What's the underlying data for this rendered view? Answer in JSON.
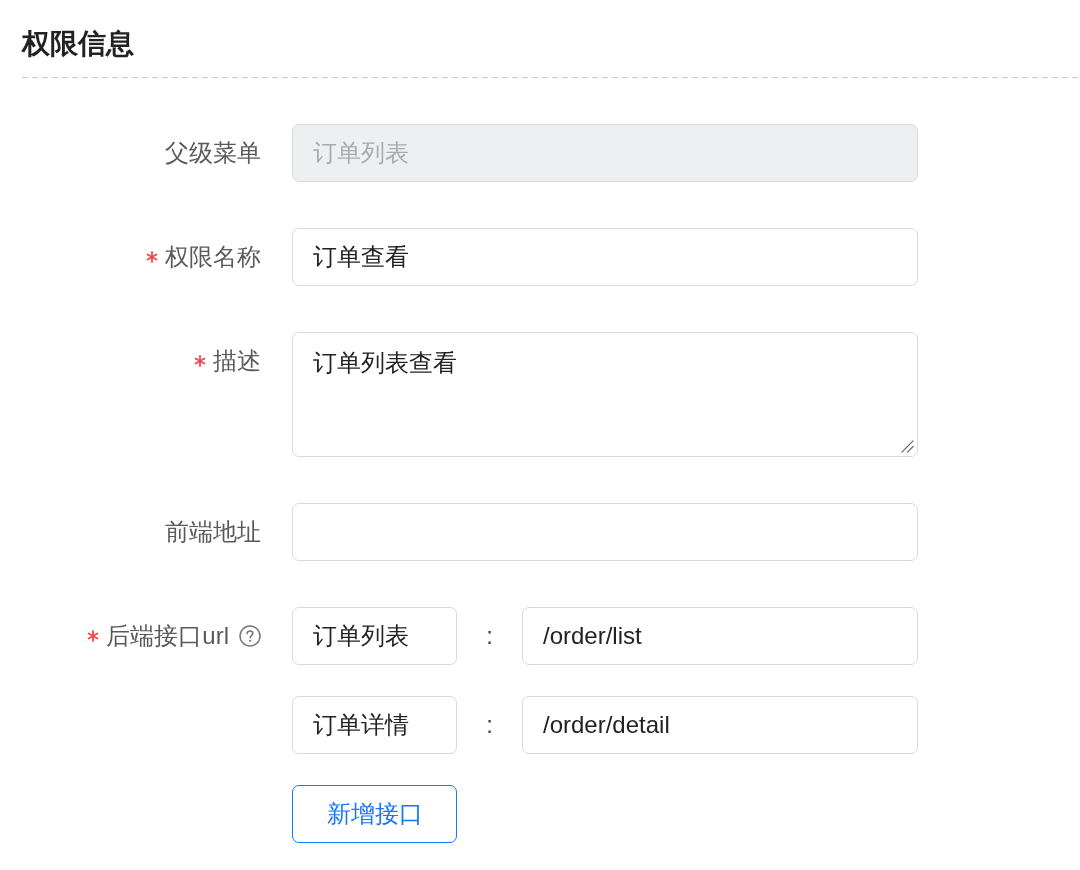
{
  "section": {
    "title": "权限信息"
  },
  "fields": [
    {
      "kind": "text",
      "label": "父级菜单",
      "required": false,
      "help": false,
      "disabled": true,
      "value": "订单列表"
    },
    {
      "kind": "text",
      "label": "权限名称",
      "required": true,
      "help": false,
      "disabled": false,
      "value": "订单查看"
    },
    {
      "kind": "textarea",
      "label": "描述",
      "required": true,
      "help": false,
      "disabled": false,
      "value": "订单列表查看"
    },
    {
      "kind": "text",
      "label": "前端地址",
      "required": false,
      "help": false,
      "disabled": false
    },
    {
      "kind": "api_list",
      "label": "后端接口url",
      "required": true,
      "help": true,
      "disabled": false,
      "rows": [
        {
          "name": "订单列表",
          "separator": ":",
          "url": "/order/list"
        },
        {
          "name": "订单详情",
          "separator": ":",
          "url": "/order/detail"
        }
      ],
      "add_button": "新增接口"
    }
  ]
}
